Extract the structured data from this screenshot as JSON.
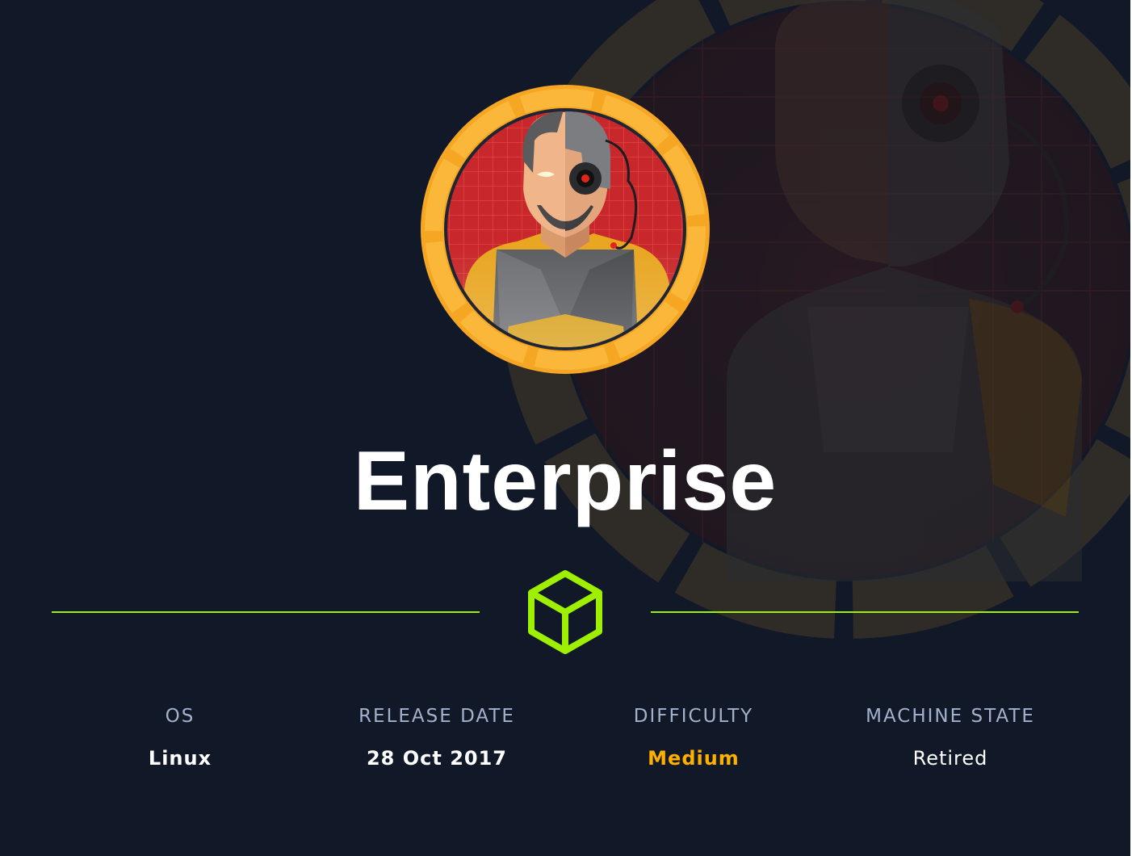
{
  "machine": {
    "name": "Enterprise",
    "avatar_icon": "cyborg-avatar-icon",
    "logo_icon": "cube-icon"
  },
  "stats": [
    {
      "label": "OS",
      "value": "Linux"
    },
    {
      "label": "RELEASE DATE",
      "value": "28 Oct 2017"
    },
    {
      "label": "DIFFICULTY",
      "value": "Medium"
    },
    {
      "label": "MACHINE STATE",
      "value": "Retired"
    }
  ],
  "colors": {
    "background": "#111827",
    "accent_green": "#9fef00",
    "difficulty_medium": "#ffaf00",
    "label_gray": "#a4b1cd",
    "ring_orange": "#f5a623",
    "avatar_red": "#c8272b"
  }
}
